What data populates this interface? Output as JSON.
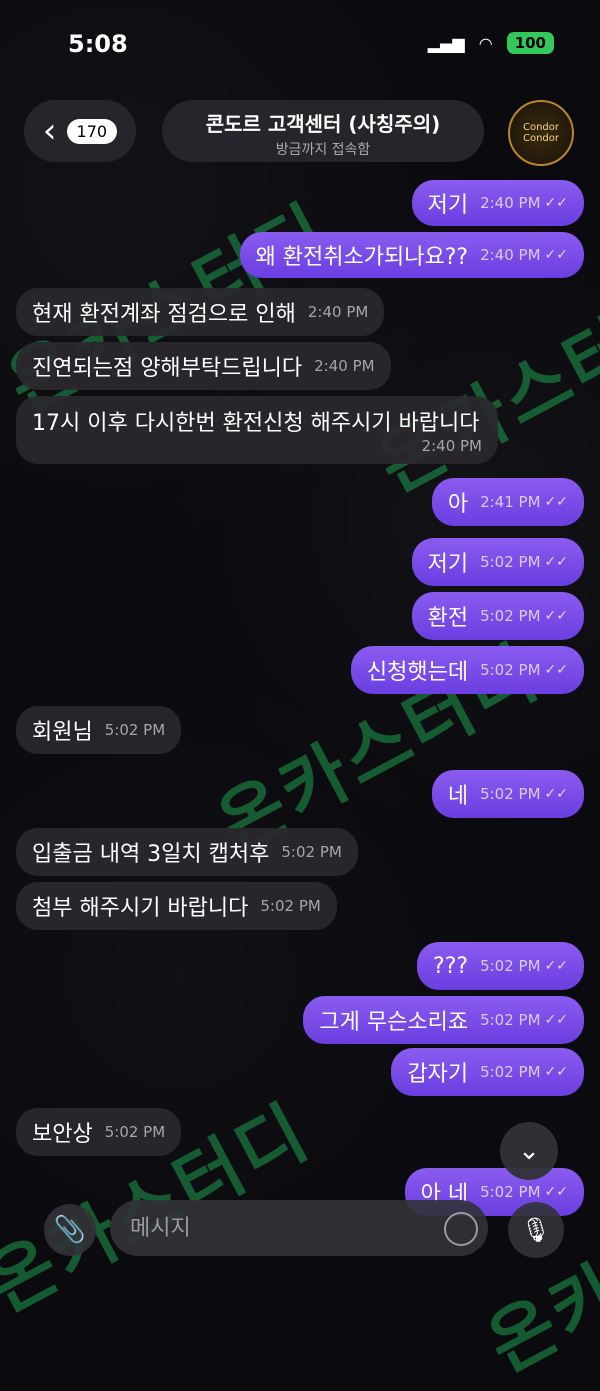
{
  "status_bar": {
    "time": "5:08",
    "battery": "100"
  },
  "header": {
    "back_count": "170",
    "title": "콘도르 고객센터 (사칭주의)",
    "subtitle": "방금까지 접속함",
    "avatar_text_top": "Condor",
    "avatar_text_bottom": "Condor"
  },
  "watermark": "온카스터디",
  "messages": [
    {
      "text": "저기",
      "time": "2:40 PM",
      "dir": "out"
    },
    {
      "text": "왜 환전취소가되나요??",
      "time": "2:40 PM",
      "dir": "out"
    },
    {
      "text": "현재 환전계좌 점검으로 인해",
      "time": "2:40 PM",
      "dir": "in"
    },
    {
      "text": "진연되는점 양해부탁드립니다",
      "time": "2:40 PM",
      "dir": "in"
    },
    {
      "text": "17시 이후 다시한번 환전신청 해주시기 바랍니다",
      "time": "2:40 PM",
      "dir": "in"
    },
    {
      "text": "아",
      "time": "2:41 PM",
      "dir": "out"
    },
    {
      "text": "저기",
      "time": "5:02 PM",
      "dir": "out"
    },
    {
      "text": "환전",
      "time": "5:02 PM",
      "dir": "out"
    },
    {
      "text": "신청햇는데",
      "time": "5:02 PM",
      "dir": "out"
    },
    {
      "text": "회원님",
      "time": "5:02 PM",
      "dir": "in"
    },
    {
      "text": "네",
      "time": "5:02 PM",
      "dir": "out"
    },
    {
      "text": "입출금 내역 3일치 캡처후",
      "time": "5:02 PM",
      "dir": "in"
    },
    {
      "text": "첨부 해주시기 바랍니다",
      "time": "5:02 PM",
      "dir": "in"
    },
    {
      "text": "???",
      "time": "5:02 PM",
      "dir": "out"
    },
    {
      "text": "그게 무슨소리죠",
      "time": "5:02 PM",
      "dir": "out"
    },
    {
      "text": "갑자기",
      "time": "5:02 PM",
      "dir": "out"
    },
    {
      "text": "보안상",
      "time": "5:02 PM",
      "dir": "in"
    },
    {
      "text": "아 네",
      "time": "5:02 PM",
      "dir": "out"
    }
  ],
  "composer": {
    "placeholder": "메시지"
  }
}
